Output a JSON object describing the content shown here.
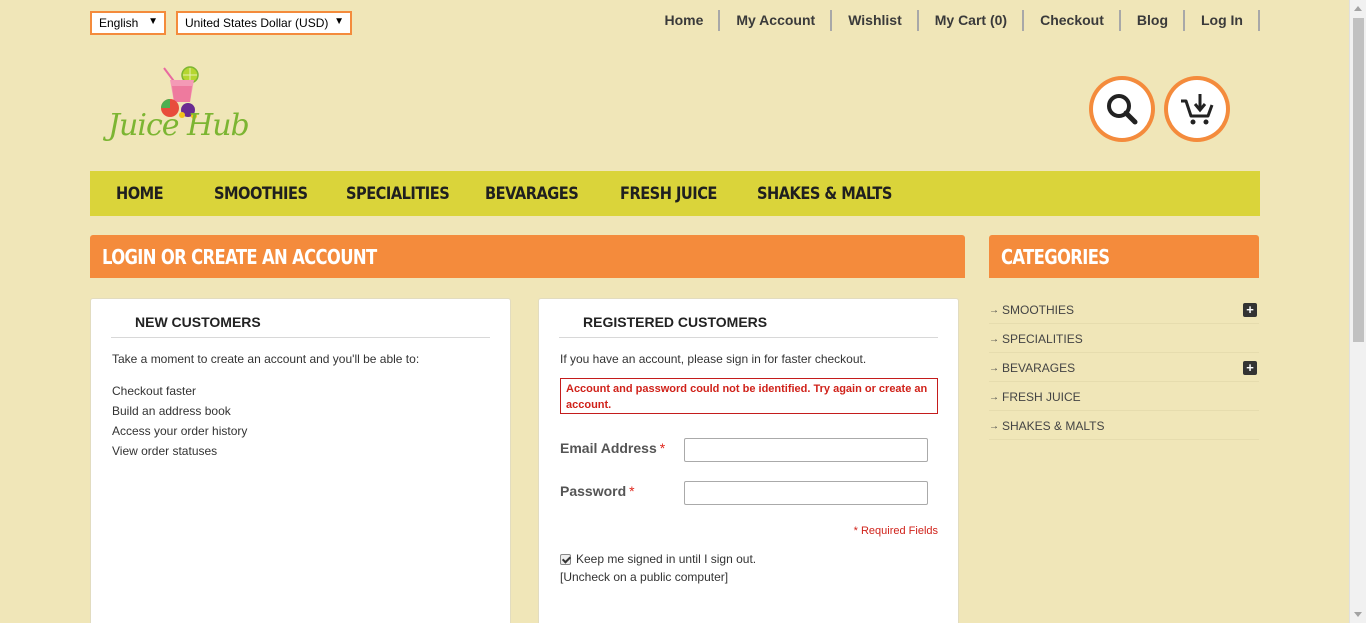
{
  "top_bar": {
    "language": "English",
    "currency": "United States Dollar (USD)",
    "links": [
      "Home",
      "My Account",
      "Wishlist",
      "My Cart (0)",
      "Checkout",
      "Blog",
      "Log In"
    ]
  },
  "logo": {
    "text": "Juice Hub"
  },
  "icons": {
    "search": "search-icon",
    "cart": "cart-download-icon"
  },
  "nav": {
    "items": [
      "HOME",
      "SMOOTHIES",
      "SPECIALITIES",
      "BEVARAGES",
      "FRESH JUICE",
      "SHAKES & MALTS"
    ]
  },
  "login": {
    "heading": "LOGIN OR CREATE AN ACCOUNT",
    "new_customers": {
      "title": "NEW CUSTOMERS",
      "intro": "Take a moment to create an account and you'll be able to:",
      "benefits": [
        "Checkout faster",
        "Build an address book",
        "Access your order history",
        "View order statuses"
      ]
    },
    "registered": {
      "title": "REGISTERED CUSTOMERS",
      "intro": "If you have an account, please sign in for faster checkout.",
      "error": "Account and password could not be identified. Try again or create an account.",
      "email_label": "Email Address",
      "password_label": "Password",
      "required_mark": "*",
      "email_value": "",
      "password_value": "",
      "required_note": "* Required Fields",
      "remember_label": "Keep me signed in until I sign out.",
      "remember_checked": true,
      "public_note": "[Uncheck on a public computer]"
    }
  },
  "categories": {
    "heading": "CATEGORIES",
    "items": [
      {
        "label": "SMOOTHIES",
        "expandable": true
      },
      {
        "label": "SPECIALITIES",
        "expandable": false
      },
      {
        "label": "BEVARAGES",
        "expandable": true
      },
      {
        "label": "FRESH JUICE",
        "expandable": false
      },
      {
        "label": "SHAKES & MALTS",
        "expandable": false
      }
    ]
  },
  "colors": {
    "background": "#f0e6b8",
    "accent_orange": "#f48b3c",
    "nav_yellow": "#dad43a",
    "error_red": "#d0221a",
    "logo_green": "#7cb532"
  }
}
